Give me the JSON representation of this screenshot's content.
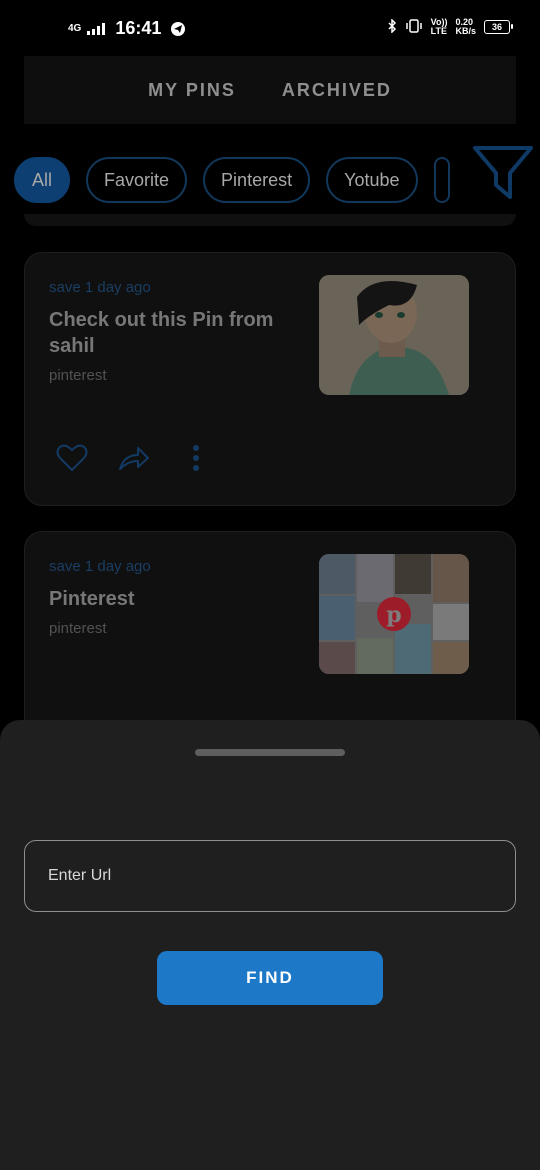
{
  "status_bar": {
    "network": "4G",
    "time": "16:41",
    "volte": "Vo))",
    "lte": "LTE",
    "speed_value": "0.20",
    "speed_unit": "KB/s",
    "battery": "36"
  },
  "header": {
    "tabs": [
      {
        "label": "MY PINS"
      },
      {
        "label": "ARCHIVED"
      }
    ]
  },
  "filters": {
    "chips": [
      {
        "label": "All"
      },
      {
        "label": "Favorite"
      },
      {
        "label": "Pinterest"
      },
      {
        "label": "Yotube"
      }
    ]
  },
  "pins": [
    {
      "date": "save 1 day ago",
      "title": "Check out this Pin from sahil",
      "source": "pinterest",
      "thumb_icon": "anime-girl-illustration"
    },
    {
      "date": "save 1 day ago",
      "title": "Pinterest",
      "source": "pinterest",
      "thumb_icon": "pinterest-collage"
    }
  ],
  "sheet": {
    "input_placeholder": "Enter Url",
    "find_label": "FIND"
  },
  "colors": {
    "accent": "#1d78c7",
    "chip_active": "#0d3f72",
    "sheet_bg": "#1f1f1f"
  }
}
